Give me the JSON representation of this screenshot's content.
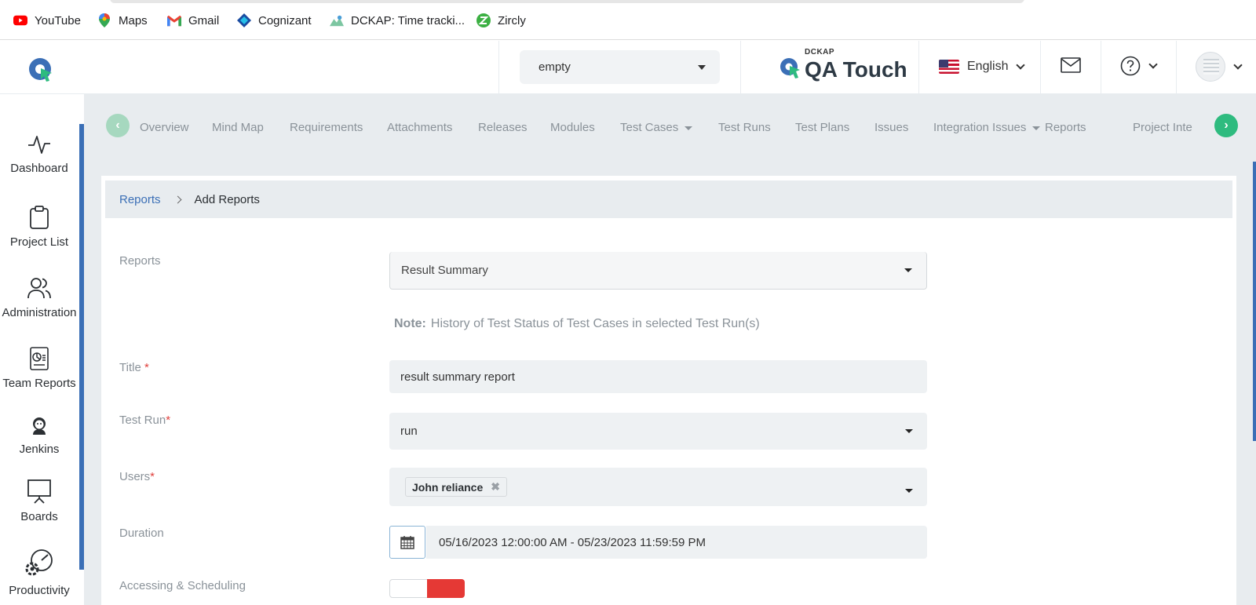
{
  "bookmarks": [
    {
      "label": "YouTube",
      "icon": "youtube-icon"
    },
    {
      "label": "Maps",
      "icon": "maps-icon"
    },
    {
      "label": "Gmail",
      "icon": "gmail-icon"
    },
    {
      "label": "Cognizant",
      "icon": "cognizant-icon"
    },
    {
      "label": "DCKAP: Time tracki...",
      "icon": "dckap-icon"
    },
    {
      "label": "Zircly",
      "icon": "zircly-icon"
    }
  ],
  "header": {
    "project_value": "empty",
    "brand_top": "DCKAP",
    "brand_name": "QA Touch",
    "language": "English"
  },
  "sidebar": {
    "items": [
      {
        "label": "Dashboard",
        "icon": "pulse-icon"
      },
      {
        "label": "Project List",
        "icon": "clipboard-icon"
      },
      {
        "label": "Administration",
        "icon": "users-icon"
      },
      {
        "label": "Team Reports",
        "icon": "report-icon"
      },
      {
        "label": "Jenkins",
        "icon": "jenkins-icon"
      },
      {
        "label": "Boards",
        "icon": "board-icon"
      },
      {
        "label": "Productivity",
        "icon": "gauge-icon"
      }
    ]
  },
  "tabs": {
    "items": [
      "Overview",
      "Mind Map",
      "Requirements",
      "Attachments",
      "Releases",
      "Modules",
      "Test Cases",
      "Test Runs",
      "Test Plans",
      "Issues",
      "Integration Issues",
      "Reports",
      "Project Inte"
    ]
  },
  "breadcrumb": {
    "parent": "Reports",
    "current": "Add Reports"
  },
  "form": {
    "reports_label": "Reports",
    "reports_value": "Result Summary",
    "note_prefix": "Note:",
    "note_text": "History of Test Status of Test Cases in selected Test Run(s)",
    "title_label": "Title",
    "title_value": "result summary report",
    "test_run_label": "Test Run",
    "test_run_value": "run",
    "users_label": "Users",
    "users_tags": [
      "John reliance"
    ],
    "duration_label": "Duration",
    "duration_value": "05/16/2023 12:00:00 AM - 05/23/2023 11:59:59 PM",
    "scheduling_label": "Accessing & Scheduling",
    "required_mark": "*"
  }
}
